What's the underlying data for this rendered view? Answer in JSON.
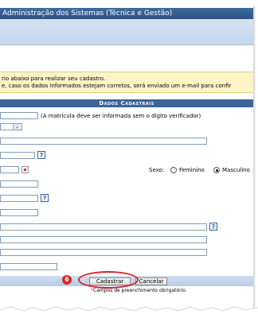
{
  "window": {
    "title": "Administração dos Sistemas (Técnica e Gestão)"
  },
  "notice": {
    "line1": "rio abaixo para realizar seu cadastro.",
    "line2": "e, caso os dados informados estejam corretos, será enviado um e-mail para confir"
  },
  "form": {
    "section_title": "Dados Cadastrais",
    "matricula_hint": "(A matrícula deve ser informada sem o dígito verificador)",
    "sex_label": "Sexo:",
    "sex_options": [
      {
        "label": "Feminino",
        "checked": false
      },
      {
        "label": "Masculino",
        "checked": true
      }
    ],
    "help_glyph": "?"
  },
  "actions": {
    "step_number": "6",
    "submit_label": "Cadastrar",
    "cancel_label": "Cancelar"
  },
  "footer": {
    "mandatory_star": "*",
    "mandatory_text": "Campos de preenchimento obrigatório."
  },
  "colors": {
    "accent_header": "#3b649a",
    "highlight": "#d8232a",
    "notice_bg": "#fdf4c6"
  }
}
